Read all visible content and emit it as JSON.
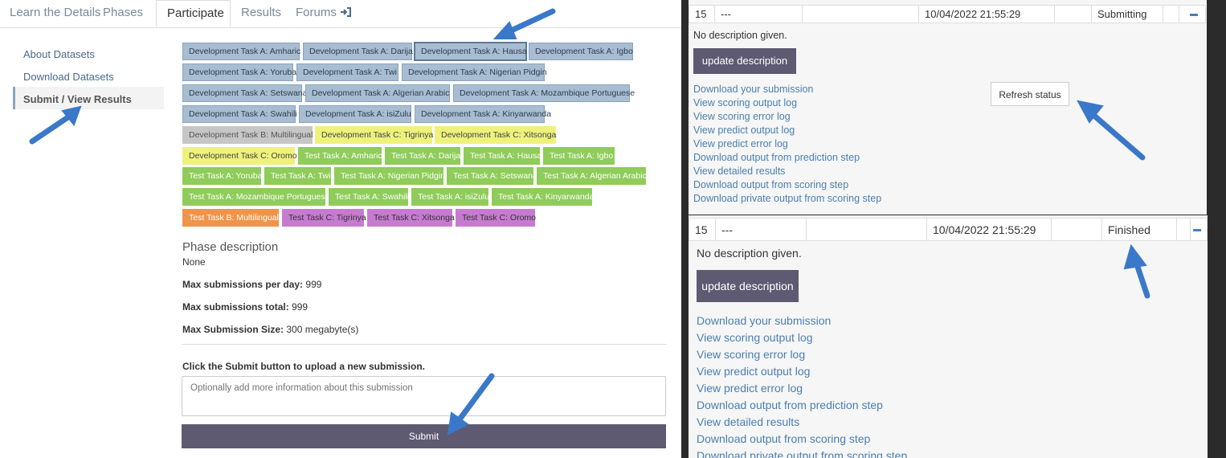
{
  "tabs": [
    "Learn the Details",
    "Phases",
    "Participate",
    "Results",
    "Forums"
  ],
  "sidebar": [
    "About Datasets",
    "Download Datasets",
    "Submit / View Results"
  ],
  "phases": [
    {
      "label": "Development Task A: Amharic",
      "color": "dev"
    },
    {
      "label": "Development Task A: Darija",
      "color": "dev"
    },
    {
      "label": "Development Task A: Hausa",
      "color": "dev-selected"
    },
    {
      "label": "Development Task A: Igbo",
      "color": "dev"
    },
    {
      "label": "Development Task A: Yoruba",
      "color": "dev"
    },
    {
      "label": "Development Task A: Twi",
      "color": "dev"
    },
    {
      "label": "Development Task A: Nigerian Pidgin",
      "color": "dev"
    },
    {
      "label": "Development Task A: Setswana",
      "color": "dev"
    },
    {
      "label": "Development Task A: Algerian Arabic",
      "color": "dev"
    },
    {
      "label": "Development Task A: Mozambique Portuguese",
      "color": "dev"
    },
    {
      "label": "Development Task A: Swahili",
      "color": "dev"
    },
    {
      "label": "Development Task A: isiZulu",
      "color": "dev"
    },
    {
      "label": "Development Task A: Kinyarwanda",
      "color": "dev"
    },
    {
      "label": "Development Task B: Multilingual",
      "color": "grey"
    },
    {
      "label": "Development Task C: Tigrinya",
      "color": "yellow"
    },
    {
      "label": "Development Task C: Xitsonga",
      "color": "yellow"
    },
    {
      "label": "Development Task C: Oromo",
      "color": "yellow"
    },
    {
      "label": "Test Task A: Amharic",
      "color": "green"
    },
    {
      "label": "Test Task A: Darija",
      "color": "green"
    },
    {
      "label": "Test Task A: Hausa",
      "color": "green"
    },
    {
      "label": "Test Task A: Igbo",
      "color": "green"
    },
    {
      "label": "Test Task A: Yoruba",
      "color": "green"
    },
    {
      "label": "Test Task A: Twi",
      "color": "green"
    },
    {
      "label": "Test Task A: Nigerian Pidgin",
      "color": "green"
    },
    {
      "label": "Test Task A: Setswana",
      "color": "green"
    },
    {
      "label": "Test Task A: Algerian Arabic",
      "color": "green"
    },
    {
      "label": "Test Task A: Mozambique Portuguese",
      "color": "green"
    },
    {
      "label": "Test Task A: Swahili",
      "color": "green"
    },
    {
      "label": "Test Task A: isiZulu",
      "color": "green"
    },
    {
      "label": "Test Task A: Kinyarwanda",
      "color": "green"
    },
    {
      "label": "Test Task B: Multilingual",
      "color": "orange"
    },
    {
      "label": "Test Task C: Tigrinya",
      "color": "purple"
    },
    {
      "label": "Test Task C: Xitsonga",
      "color": "purple"
    },
    {
      "label": "Test Task C: Oromo",
      "color": "purple"
    }
  ],
  "phase_description": {
    "heading": "Phase description",
    "value": "None"
  },
  "limits": [
    {
      "label": "Max submissions per day:",
      "value": "999"
    },
    {
      "label": "Max submissions total:",
      "value": "999"
    },
    {
      "label": "Max Submission Size:",
      "value": "300 megabyte(s)"
    }
  ],
  "submit": {
    "instruction": "Click the Submit button to upload a new submission.",
    "placeholder": "Optionally add more information about this submission",
    "button": "Submit"
  },
  "submissions": [
    {
      "number": "15",
      "description_cell": "---",
      "date": "10/04/2022 21:55:29",
      "status": "Submitting",
      "no_description": "No description given.",
      "update_label": "update description",
      "refresh_label": "Refresh status",
      "links": [
        "Download your submission",
        "View scoring output log",
        "View scoring error log",
        "View predict output log",
        "View predict error log",
        "Download output from prediction step",
        "View detailed results",
        "Download output from scoring step",
        "Download private output from scoring step"
      ]
    },
    {
      "number": "15",
      "description_cell": "---",
      "date": "10/04/2022 21:55:29",
      "status": "Finished",
      "no_description": "No description given.",
      "update_label": "update description",
      "links": [
        "Download your submission",
        "View scoring output log",
        "View scoring error log",
        "View predict output log",
        "View predict error log",
        "Download output from prediction step",
        "View detailed results",
        "Download output from scoring step",
        "Download private output from scoring step"
      ]
    }
  ],
  "colors": {
    "accent": "#5e5a72",
    "link": "#4a7fb0",
    "arrow": "#3a78c9"
  }
}
